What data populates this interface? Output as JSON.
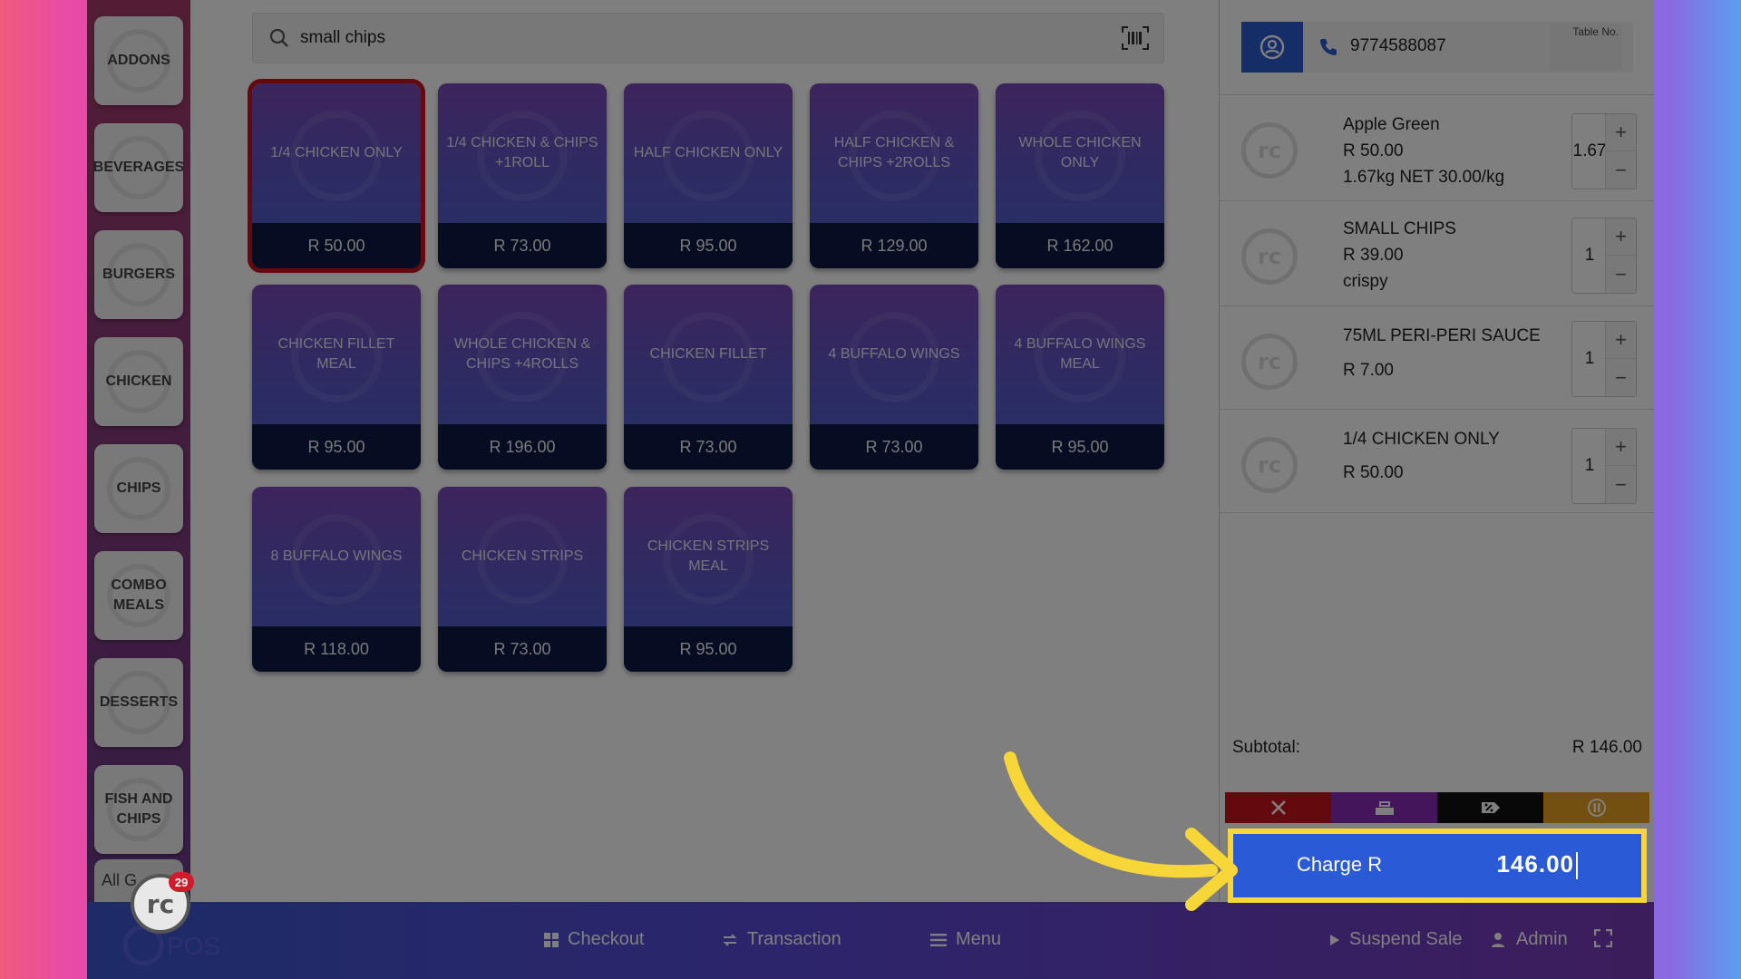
{
  "search": {
    "query": "small chips"
  },
  "categories": [
    {
      "label": "ADDONS"
    },
    {
      "label": "BEVERAGES"
    },
    {
      "label": "BURGERS"
    },
    {
      "label": "CHICKEN"
    },
    {
      "label": "CHIPS"
    },
    {
      "label": "COMBO MEALS"
    },
    {
      "label": "DESSERTS"
    },
    {
      "label": "FISH AND CHIPS"
    }
  ],
  "all_groups_label": "All G",
  "badge_count": "29",
  "products": [
    {
      "name": "1/4 CHICKEN ONLY",
      "price": "R 50.00"
    },
    {
      "name": "1/4 CHICKEN & CHIPS +1ROLL",
      "price": "R 73.00"
    },
    {
      "name": "HALF CHICKEN ONLY",
      "price": "R 95.00"
    },
    {
      "name": "HALF CHICKEN & CHIPS +2ROLLS",
      "price": "R 129.00"
    },
    {
      "name": "WHOLE CHICKEN ONLY",
      "price": "R 162.00"
    },
    {
      "name": "CHICKEN FILLET MEAL",
      "price": "R 95.00"
    },
    {
      "name": "WHOLE CHICKEN & CHIPS +4ROLLS",
      "price": "R 196.00"
    },
    {
      "name": "CHICKEN FILLET",
      "price": "R 73.00"
    },
    {
      "name": "4 BUFFALO WINGS",
      "price": "R 73.00"
    },
    {
      "name": "4 BUFFALO WINGS MEAL",
      "price": "R 95.00"
    },
    {
      "name": "8 BUFFALO WINGS",
      "price": "R 118.00"
    },
    {
      "name": "CHICKEN STRIPS",
      "price": "R 73.00"
    },
    {
      "name": "CHICKEN STRIPS MEAL",
      "price": "R 95.00"
    }
  ],
  "customer": {
    "phone": "9774588087",
    "table_label": "Table No."
  },
  "cart": [
    {
      "name": "Apple Green",
      "price": "R 50.00",
      "note": "1.67kg NET 30.00/kg",
      "qty": "1.67"
    },
    {
      "name": "SMALL CHIPS",
      "price": "R 39.00",
      "note": "crispy",
      "qty": "1"
    },
    {
      "name": "75ML PERI-PERI SAUCE",
      "price": "R 7.00",
      "note": "",
      "qty": "1"
    },
    {
      "name": "1/4 CHICKEN ONLY",
      "price": "R 50.00",
      "note": "",
      "qty": "1"
    }
  ],
  "subtotal": {
    "label": "Subtotal:",
    "value": "R 146.00"
  },
  "charge": {
    "label": "Charge R",
    "amount": "146.00"
  },
  "nav": {
    "checkout": "Checkout",
    "transaction": "Transaction",
    "menu": "Menu",
    "suspend": "Suspend Sale",
    "admin": "Admin",
    "logo_text": "POS"
  },
  "colors": {
    "accent": "#2a5ad6",
    "highlight": "#f7d63a",
    "cancel": "#c8141e",
    "purple_action": "#8a2ab8",
    "discount_action": "#111111",
    "hold_action": "#e8a020"
  },
  "icons": {
    "search": "search-icon",
    "barcode": "barcode-icon",
    "user": "user-icon",
    "phone": "phone-icon",
    "cancel": "close-icon",
    "cash": "cash-register-icon",
    "discount": "discount-icon",
    "hold": "pause-icon",
    "fullscreen": "fullscreen-icon"
  }
}
